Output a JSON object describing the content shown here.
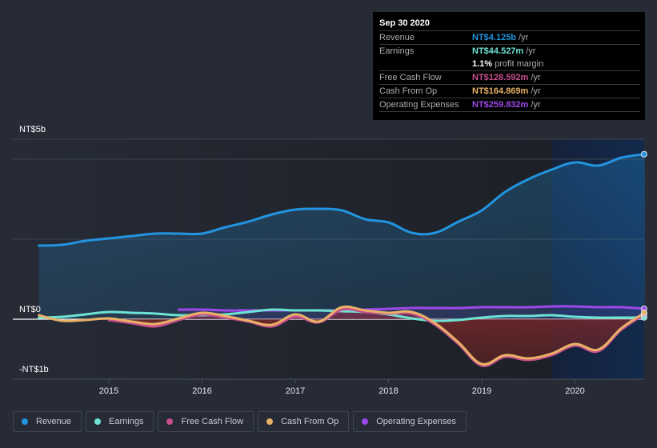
{
  "tooltip": {
    "date": "Sep 30 2020",
    "rows": [
      {
        "label": "Revenue",
        "value": "NT$4.125b",
        "unit": "/yr",
        "color": "#2394df"
      },
      {
        "label": "Earnings",
        "value": "NT$44.527m",
        "unit": "/yr",
        "color": "#6de3d3",
        "sub_value": "1.1%",
        "sub_text": "profit margin"
      },
      {
        "label": "Free Cash Flow",
        "value": "NT$128.592m",
        "unit": "/yr",
        "color": "#c94f8e"
      },
      {
        "label": "Cash From Op",
        "value": "NT$164.869m",
        "unit": "/yr",
        "color": "#e9b266"
      },
      {
        "label": "Operating Expenses",
        "value": "NT$259.832m",
        "unit": "/yr",
        "color": "#9d48e8"
      }
    ]
  },
  "legend": [
    {
      "label": "Revenue",
      "color": "#2394df"
    },
    {
      "label": "Earnings",
      "color": "#6de3d3"
    },
    {
      "label": "Free Cash Flow",
      "color": "#c94f8e"
    },
    {
      "label": "Cash From Op",
      "color": "#e9b266"
    },
    {
      "label": "Operating Expenses",
      "color": "#9d48e8"
    }
  ],
  "chart_data": {
    "type": "line",
    "title": "",
    "xlabel": "",
    "ylabel": "",
    "y_tick_labels": [
      "NT$5b",
      "NT$0",
      "-NT$1b"
    ],
    "x_tick_labels": [
      "2015",
      "2016",
      "2017",
      "2018",
      "2019",
      "2020"
    ],
    "x_ticks": [
      2015,
      2016,
      2017,
      2018,
      2019,
      2020
    ],
    "xlim": [
      2013.4,
      2020.76
    ],
    "ylim": [
      -1.5,
      4.5
    ],
    "units": "NT$ billions",
    "grid": true,
    "legend_position": "bottom",
    "highlight_range": [
      2019.75,
      2020.75
    ],
    "x": [
      2014.25,
      2014.5,
      2014.75,
      2015.0,
      2015.25,
      2015.5,
      2015.75,
      2016.0,
      2016.25,
      2016.5,
      2016.75,
      2017.0,
      2017.25,
      2017.5,
      2017.75,
      2018.0,
      2018.25,
      2018.5,
      2018.75,
      2019.0,
      2019.25,
      2019.5,
      2019.75,
      2020.0,
      2020.25,
      2020.5,
      2020.75
    ],
    "series": [
      {
        "name": "Revenue",
        "color": "#2394df",
        "area": true,
        "values": [
          1.84,
          1.86,
          1.96,
          2.02,
          2.08,
          2.14,
          2.14,
          2.14,
          2.3,
          2.44,
          2.62,
          2.74,
          2.76,
          2.72,
          2.5,
          2.42,
          2.16,
          2.16,
          2.44,
          2.72,
          3.18,
          3.5,
          3.74,
          3.92,
          3.84,
          4.04,
          4.125
        ]
      },
      {
        "name": "Earnings",
        "color": "#6de3d3",
        "area": false,
        "values": [
          0.04,
          0.06,
          0.12,
          0.18,
          0.16,
          0.14,
          0.1,
          0.1,
          0.12,
          0.18,
          0.24,
          0.22,
          0.22,
          0.2,
          0.18,
          0.12,
          0.02,
          -0.04,
          -0.02,
          0.04,
          0.08,
          0.08,
          0.1,
          0.06,
          0.04,
          0.04,
          0.045
        ]
      },
      {
        "name": "Free Cash Flow",
        "color": "#c94f8e",
        "area": true,
        "values": [
          null,
          null,
          null,
          -0.02,
          -0.1,
          -0.18,
          -0.02,
          0.12,
          0.04,
          -0.06,
          -0.18,
          0.06,
          -0.08,
          0.24,
          0.18,
          0.14,
          0.14,
          -0.14,
          -0.62,
          -1.16,
          -0.94,
          -1.02,
          -0.9,
          -0.66,
          -0.8,
          -0.26,
          0.129
        ]
      },
      {
        "name": "Cash From Op",
        "color": "#e9b266",
        "area": false,
        "values": [
          0.1,
          -0.04,
          -0.02,
          0.02,
          -0.06,
          -0.12,
          0.02,
          0.16,
          0.08,
          -0.04,
          -0.14,
          0.12,
          -0.06,
          0.3,
          0.22,
          0.16,
          0.18,
          -0.1,
          -0.58,
          -1.12,
          -0.9,
          -0.98,
          -0.86,
          -0.62,
          -0.76,
          -0.22,
          0.165
        ]
      },
      {
        "name": "Operating Expenses",
        "color": "#9d48e8",
        "area": true,
        "values": [
          null,
          null,
          null,
          null,
          null,
          null,
          0.24,
          0.24,
          0.22,
          0.22,
          0.22,
          0.22,
          0.22,
          0.22,
          0.24,
          0.26,
          0.28,
          0.28,
          0.28,
          0.3,
          0.3,
          0.3,
          0.32,
          0.32,
          0.3,
          0.3,
          0.26
        ]
      }
    ]
  }
}
